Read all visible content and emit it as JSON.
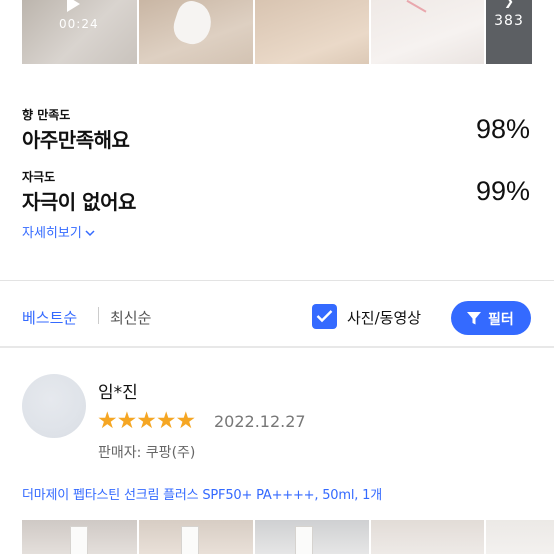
{
  "photo_strip": {
    "video_duration": "00:24",
    "more_count": "383"
  },
  "ratings": [
    {
      "label": "향 만족도",
      "value": "아주만족해요",
      "percent": "98%"
    },
    {
      "label": "자극도",
      "value": "자극이 없어요",
      "percent": "99%"
    }
  ],
  "details_link": "자세히보기",
  "sort": {
    "best": "베스트순",
    "newest": "최신순"
  },
  "photo_video_filter": {
    "label": "사진/동영상",
    "checked": true
  },
  "filter_button": "필터",
  "review": {
    "reviewer": "임*진",
    "stars": "★★★★★",
    "rating": 5,
    "date": "2022.12.27",
    "seller": "판매자: 쿠팡(주)",
    "product_option": "더마제이 펩타스틴 선크림 플러스 SPF50+ PA++++, 50ml, 1개"
  },
  "colors": {
    "accent": "#346aff",
    "star": "#f5a623"
  }
}
